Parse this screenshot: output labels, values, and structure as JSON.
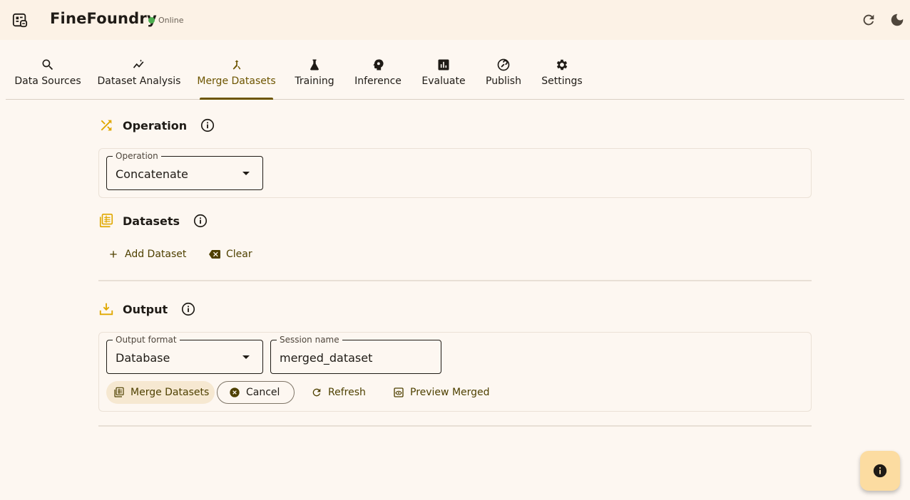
{
  "app": {
    "title": "FineFoundry",
    "status": "Online",
    "status_color": "#4caf50",
    "accent": "#6d5500",
    "icon_color": "#e0a800"
  },
  "header": {
    "refresh_icon": "refresh-icon",
    "theme_icon": "dark-mode-icon"
  },
  "tabs": [
    {
      "label": "Data Sources",
      "icon": "search-icon"
    },
    {
      "label": "Dataset Analysis",
      "icon": "insights-icon"
    },
    {
      "label": "Merge Datasets",
      "icon": "merge-icon",
      "active": true
    },
    {
      "label": "Training",
      "icon": "flask-icon"
    },
    {
      "label": "Inference",
      "icon": "psychology-icon"
    },
    {
      "label": "Evaluate",
      "icon": "bar-chart-icon"
    },
    {
      "label": "Publish",
      "icon": "publish-icon"
    },
    {
      "label": "Settings",
      "icon": "gear-icon"
    }
  ],
  "operation": {
    "title": "Operation",
    "field_label": "Operation",
    "field_value": "Concatenate"
  },
  "datasets": {
    "title": "Datasets",
    "add_label": "Add Dataset",
    "clear_label": "Clear"
  },
  "output": {
    "title": "Output",
    "format_label": "Output format",
    "format_value": "Database",
    "session_label": "Session name",
    "session_value": "merged_dataset",
    "merge_label": "Merge Datasets",
    "cancel_label": "Cancel",
    "refresh_label": "Refresh",
    "preview_label": "Preview Merged"
  },
  "fab": {
    "icon": "info-icon"
  }
}
